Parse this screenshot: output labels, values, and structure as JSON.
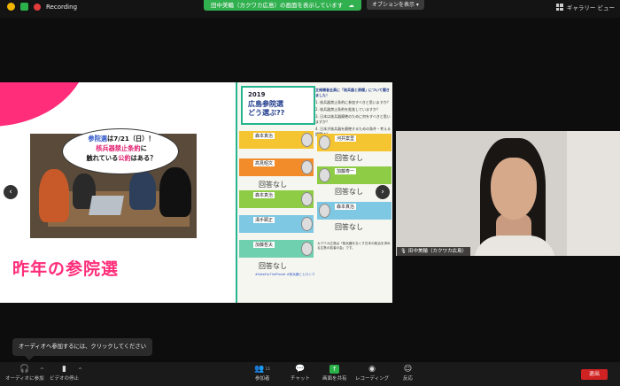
{
  "topbar": {
    "recording_label": "Recording",
    "share_banner": "田中美輪（カクワカ広島）の画面を表示しています",
    "options_button": "オプションを表示",
    "gallery_button": "ギャラリー ビュー"
  },
  "slide": {
    "bubble_line1_blue": "参院選",
    "bubble_line1_rest": "は7/21（日）！",
    "bubble_line2_red": "核兵器禁止条約",
    "bubble_line2_rest": "に",
    "bubble_line3_a": "触れている",
    "bubble_line3_red": "公約",
    "bubble_line3_b": "はある？",
    "title": "昨年の参院選",
    "prev_arrow": "‹",
    "next_arrow": "›"
  },
  "flyer": {
    "year": "2019",
    "title_line1": "広島参院選",
    "title_line2": "どう選ぶ??",
    "header": "立候補者全員に「核兵器と原爆」について聞きました！",
    "questions": [
      "1. 核兵器禁止条約に参加すべきと思いますか？",
      "2. 核兵器禁止条約を批准していますか？",
      "3. 日本は核兵器廃絶のために何をすべきと思いますか？",
      "4. 日本が核兵器を廃絶するための条件・考える課題は？"
    ],
    "candidates": [
      "森本真治",
      "河井案里",
      "高見昭文",
      "加藤寿一",
      "溝手顕正",
      "森本真治",
      "加藤哲夫"
    ],
    "no_answer": "回答なし",
    "footer_note": "カクワカ広島は「核兵器をなくす日本の政治を求める広島の若者の会」です。",
    "bottom_link": "#VoteForThePlanet #核兵器とヒロシマ"
  },
  "video": {
    "participant_name": "田中美輪（カクワカ広島）"
  },
  "toast": {
    "message": "オーディオへ参加するには、クリックしてください"
  },
  "toolbar": {
    "audio": "オーディオに参加",
    "video": "ビデオの停止",
    "participants": "参加者",
    "participants_count": "11",
    "chat": "チャット",
    "share": "画面を共有",
    "record": "レコーディング",
    "reactions": "反応",
    "leave": "退出"
  },
  "colors": {
    "share_green": "#31b04f",
    "slide_pink": "#ff2d7a",
    "flyer_green": "#26b58f",
    "leave_red": "#d02222"
  }
}
